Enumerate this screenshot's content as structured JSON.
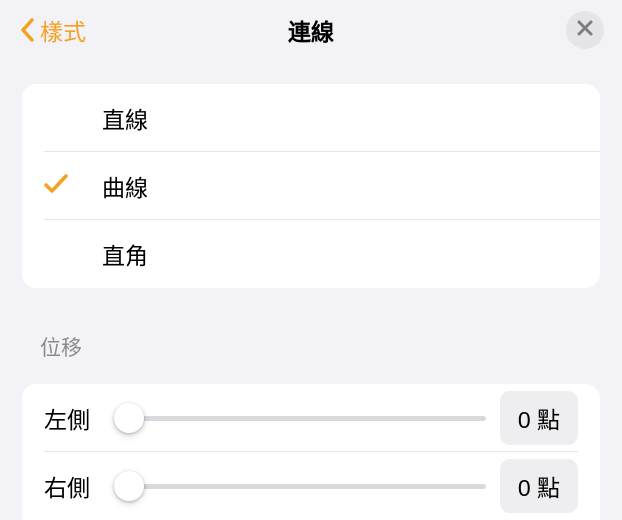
{
  "header": {
    "back_label": "樣式",
    "title": "連線"
  },
  "line_types": {
    "items": [
      {
        "label": "直線",
        "selected": false
      },
      {
        "label": "曲線",
        "selected": true
      },
      {
        "label": "直角",
        "selected": false
      }
    ]
  },
  "offset": {
    "section_label": "位移",
    "rows": [
      {
        "label": "左側",
        "value_display": "0 點",
        "value": 0
      },
      {
        "label": "右側",
        "value_display": "0 點",
        "value": 0
      }
    ]
  },
  "colors": {
    "accent": "#f5a120"
  }
}
